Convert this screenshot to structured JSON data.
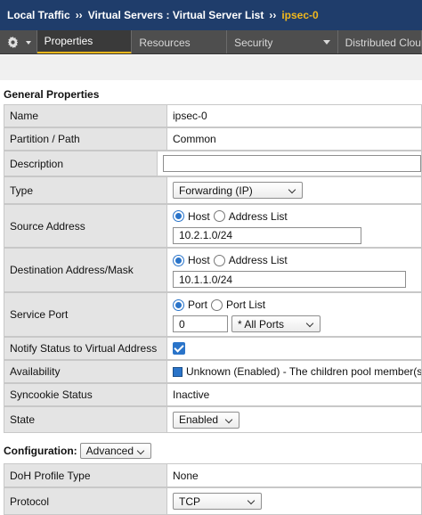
{
  "breadcrumb": {
    "root": "Local Traffic",
    "sep1": "››",
    "middle": "Virtual Servers : Virtual Server List",
    "sep2": "››",
    "current": "ipsec-0"
  },
  "tabs": [
    {
      "label": "Properties"
    },
    {
      "label": "Resources"
    },
    {
      "label": "Security"
    },
    {
      "label": "Distributed Clou"
    }
  ],
  "general": {
    "title": "General Properties",
    "name_label": "Name",
    "name_value": "ipsec-0",
    "partition_label": "Partition / Path",
    "partition_value": "Common",
    "description_label": "Description",
    "description_value": "",
    "type_label": "Type",
    "type_value": "Forwarding (IP)",
    "source_label": "Source Address",
    "source_radio_host": "Host",
    "source_radio_list": "Address List",
    "source_value": "10.2.1.0/24",
    "dest_label": "Destination Address/Mask",
    "dest_radio_host": "Host",
    "dest_radio_list": "Address List",
    "dest_value": "10.1.1.0/24",
    "port_label": "Service Port",
    "port_radio_port": "Port",
    "port_radio_list": "Port List",
    "port_value": "0",
    "port_select": "* All Ports",
    "notify_label": "Notify Status to Virtual Address",
    "notify_checked": true,
    "availability_label": "Availability",
    "availability_value": "Unknown (Enabled) - The children pool member(s)",
    "syncookie_label": "Syncookie Status",
    "syncookie_value": "Inactive",
    "state_label": "State",
    "state_value": "Enabled"
  },
  "configuration": {
    "title": "Configuration:",
    "mode": "Advanced",
    "doh_label": "DoH Profile Type",
    "doh_value": "None",
    "protocol_label": "Protocol",
    "protocol_value": "TCP"
  }
}
